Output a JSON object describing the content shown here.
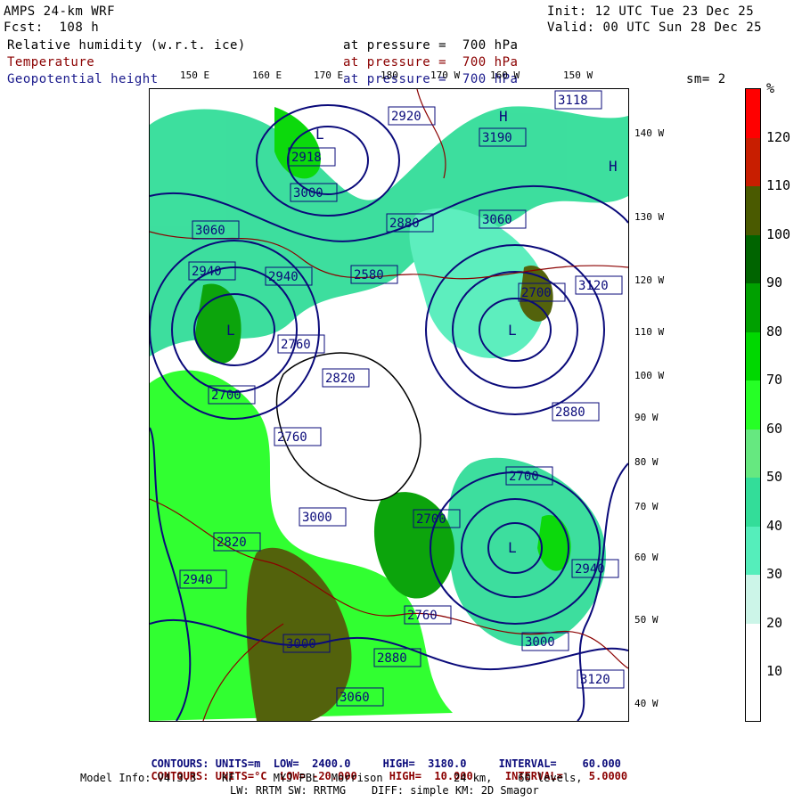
{
  "header": {
    "model": "AMPS 24-km WRF",
    "fcst": "Fcst:  108 h",
    "init": "Init: 12 UTC Tue 23 Dec 25",
    "valid": "Valid: 00 UTC Sun 28 Dec 25",
    "field1_name": "Relative humidity (w.r.t. ice)",
    "field1_level": "at pressure =  700 hPa",
    "field2_name": "Temperature",
    "field2_level": "at pressure =  700 hPa",
    "field3_name": "Geopotential height",
    "field3_level": "at pressure =  700 hPa",
    "smoothing": "sm= 2"
  },
  "lon_labels": [
    "150 E",
    "160 E",
    "170 E",
    "180",
    "170 W",
    "160 W",
    "150 W"
  ],
  "lat_labels": [
    "140 W",
    "130 W",
    "120 W",
    "110 W",
    "100 W",
    "90 W",
    "80 W",
    "70 W",
    "60 W",
    "50 W",
    "40 W"
  ],
  "colorbar": {
    "unit": "%",
    "labels": [
      "120",
      "110",
      "100",
      "90",
      "80",
      "70",
      "60",
      "50",
      "40",
      "30",
      "20",
      "10"
    ],
    "colors": [
      "#ff0000",
      "#c81e00",
      "#4a5a00",
      "#006400",
      "#00a000",
      "#00d800",
      "#26ff26",
      "#66e880",
      "#33dd99",
      "#55eebb",
      "#ccf5e8",
      "#ffffff",
      "#ffffff"
    ]
  },
  "map": {
    "height_labels": [
      "3118",
      "3190",
      "2920",
      "2918",
      "3000",
      "3060",
      "2880",
      "3060",
      "2940",
      "2700",
      "2940",
      "2580",
      "2700",
      "2760",
      "2820",
      "3000",
      "2820",
      "2700",
      "2760",
      "2880",
      "3120",
      "2700",
      "2940",
      "2880",
      "2940",
      "3000",
      "3060",
      "3120",
      "3000",
      "2760"
    ],
    "low_label": "L",
    "high_label": "H"
  },
  "footer": {
    "c1_label": "CONTOURS:",
    "c1_units": "UNITS=m",
    "c1_low": "LOW=  2400.0",
    "c1_high": "HIGH=  3180.0",
    "c1_interval": "INTERVAL=    60.000",
    "c2_label": "CONTOURS:",
    "c2_units": "UNITS=°C",
    "c2_low": "LOW= -20.000",
    "c2_high": "HIGH=  10.000",
    "c2_interval": "INTERVAL=    5.0000",
    "info1": "Model Info: V4.3.3    KF      MYJ PBL  Morrison           24 km,    60 levels,",
    "info2": "LW: RRTM SW: RRTMG    DIFF: simple KM: 2D Smagor"
  }
}
